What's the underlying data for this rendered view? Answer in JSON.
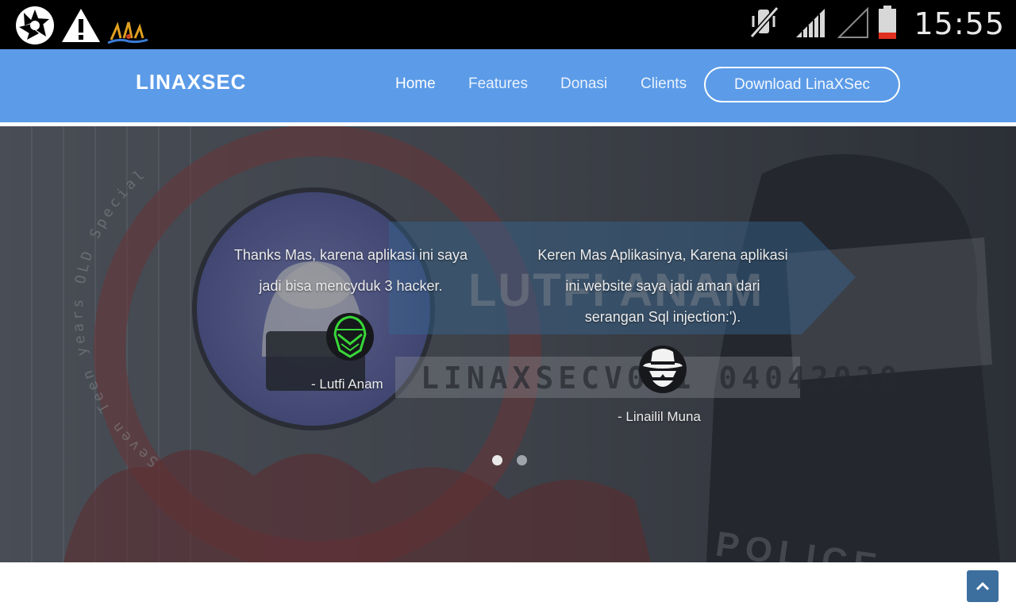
{
  "status_bar": {
    "time": "15:55",
    "left_icons": [
      "aperture-icon",
      "warning-icon",
      "app-notification-icon"
    ],
    "right_icons": [
      "vibrate-off-icon",
      "cell-signal-icon",
      "no-signal-icon",
      "battery-low-icon"
    ]
  },
  "navbar": {
    "brand": "LINAXSEC",
    "links": [
      "Home",
      "Features",
      "Donasi",
      "Clients"
    ],
    "active": "Home",
    "cta": "Download LinaXSec",
    "background_color": "#5b9be8"
  },
  "hero": {
    "background_text": {
      "ring_text": "Seven Teen years OLD Special",
      "banner": "LUTFI ANAM",
      "version": "LINAXSECV0.1 04042020",
      "police": "POLICE"
    },
    "testimonials": [
      {
        "quote_lines": [
          "Thanks Mas, karena aplikasi ini saya",
          "jadi bisa mencyduk 3 hacker."
        ],
        "author": "- Lutfi Anam",
        "avatar_icon": "green-hacker-mask-icon"
      },
      {
        "quote_lines": [
          "Keren Mas Aplikasinya, Karena aplikasi",
          "ini website saya jadi aman dari",
          "serangan Sql injection:')."
        ],
        "author": "- Linailil Muna",
        "avatar_icon": "white-spy-hat-icon"
      }
    ],
    "carousel": {
      "slides": 2,
      "active_index": 0
    }
  },
  "scroll_top": {
    "icon": "chevron-up-icon"
  }
}
